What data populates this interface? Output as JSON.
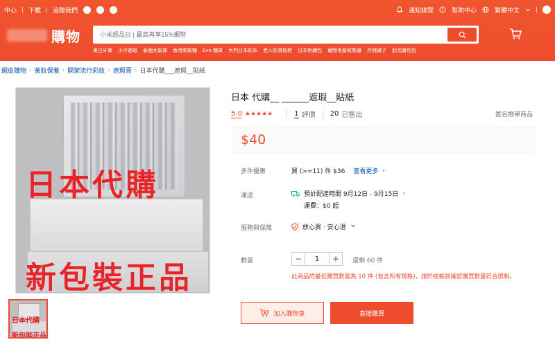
{
  "header": {
    "topnav_left": [
      "中心",
      "下載",
      "追蹤我們"
    ],
    "topnav_right": [
      "通知總覽",
      "幫助中心",
      "繁體中文"
    ],
    "logo_text": "購物",
    "search_placeholder": "小米超品日 | 最高再享15%蝦幣",
    "hotwords": [
      "美白牙膏",
      "小冷遮瑕",
      "泰國大象褲",
      "香港菜軟糖",
      "Eve 糖果",
      "大判日本貼布",
      "老人防滑拖鞋",
      "日本刺繡包",
      "寵物毛髮收集器",
      "存錢罐子",
      "起泡寶包包"
    ]
  },
  "breadcrumb": [
    "蝦皮購物",
    "美妝保養",
    "開架流行彩妝",
    "遮瑕膏",
    "日本代購___遮瑕__貼紙"
  ],
  "image": {
    "overlay_top": "日本代購",
    "overlay_bottom": "新包裝正品"
  },
  "product": {
    "title": "日本      代購__         ______遮瑕__貼紙",
    "rating": "5.0",
    "stars": "★★★★★",
    "reviews_count": "1",
    "reviews_label": "評價",
    "sold_count": "20",
    "sold_label": "已售出",
    "report": "匿名檢舉商品",
    "price": "$40"
  },
  "details": {
    "bulk_label": "多件優惠",
    "bulk_value": "買 (>=11) 件 $36",
    "bulk_more": "查看更多",
    "shipping_label": "運送",
    "shipping_eta": "預計配達時間 9月12日 - 9月15日",
    "shipping_fee": "運費：$0 起",
    "service_label": "服務與保障",
    "service_value": "放心買 · 安心退",
    "quantity_label": "數量",
    "quantity_value": "1",
    "stock": "還剩 60 件",
    "notice": "此商品的最低購買數量為 10 件 (包含所有規格)，請於結帳前確認購買數量符合限制。"
  },
  "actions": {
    "add_to_cart": "加入購物車",
    "buy_now": "直接購買"
  }
}
